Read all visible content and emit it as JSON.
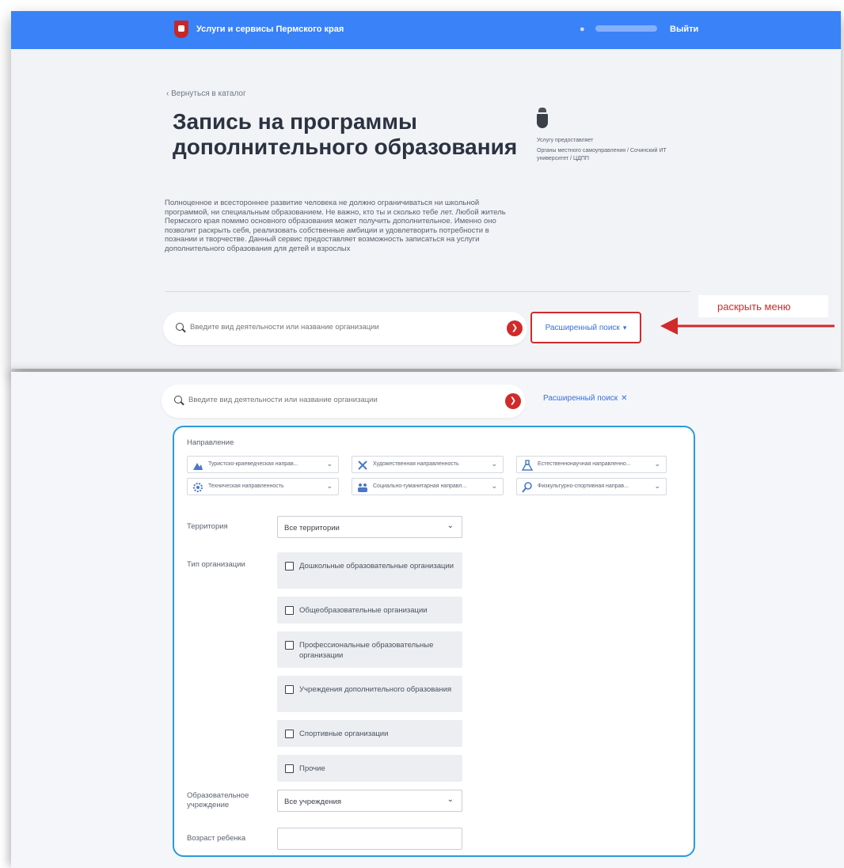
{
  "header": {
    "site_title": "Услуги и сервисы Пермского края",
    "logout": "Выйти"
  },
  "page": {
    "back_link": "‹  Вернуться в каталог",
    "title": "Запись на программы дополнительного образования",
    "description": "Полноценное и всестороннее развитие человека не должно ограничиваться ни школьной программой, ни специальным образованием. Не важно, кто ты и сколько тебе лет. Любой житель Пермского края помимо основного образования может получить дополнительное. Именно оно позволит раскрыть себя, реализовать собственные амбиции и удовлетворить потребности в познании и творчестве. Данный сервис предоставляет возможность записаться на услуги дополнительного образования для детей и взрослых",
    "provider_label": "Услугу предоставляет",
    "provider_name": "Органы местного самоуправления / Сочинский ИТ университет / ЦДПП"
  },
  "search": {
    "placeholder": "Введите вид деятельности или название организации",
    "advanced_label": "Расширенный поиск"
  },
  "annotation": {
    "label": "раскрыть меню"
  },
  "filters": {
    "direction_label": "Направление",
    "directions": [
      "Туристско-краеведческая направ...",
      "Художественная направленность",
      "Естественнонаучная направленно...",
      "Техническая направленность",
      "Социально-гуманитарная направл...",
      "Физкультурно-спортивная направ..."
    ],
    "territory_label": "Территория",
    "territory_value": "Все территории",
    "org_type_label": "Тип организации",
    "org_types": [
      "Дошкольные образовательные организации",
      "Общеобразовательные организации",
      "Профессиональные образовательные организации",
      "Учреждения дополнительного образования",
      "Спортивные организации",
      "Прочие"
    ],
    "institution_label": "Образовательное учреждение",
    "institution_value": "Все учреждения",
    "age_label": "Возраст ребенка",
    "age_value": ""
  },
  "colors": {
    "header": "#3a82f7",
    "accent_red": "#d12a2a",
    "link_blue": "#3a6fd8",
    "panel_border": "#2a9bd8"
  }
}
